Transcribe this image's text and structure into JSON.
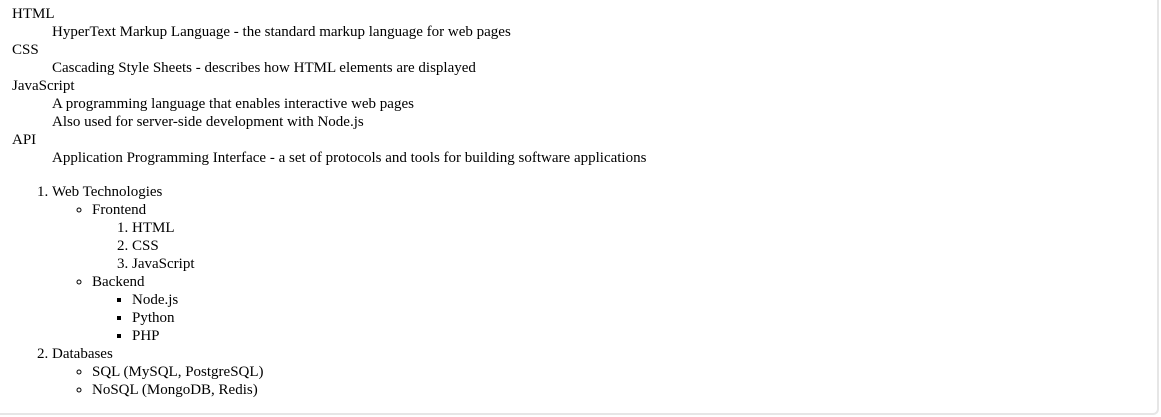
{
  "definitions": [
    {
      "term": "HTML",
      "descriptions": [
        "HyperText Markup Language - the standard markup language for web pages"
      ]
    },
    {
      "term": "CSS",
      "descriptions": [
        "Cascading Style Sheets - describes how HTML elements are displayed"
      ]
    },
    {
      "term": "JavaScript",
      "descriptions": [
        "A programming language that enables interactive web pages",
        "Also used for server-side development with Node.js"
      ]
    },
    {
      "term": "API",
      "descriptions": [
        "Application Programming Interface - a set of protocols and tools for building software applications"
      ]
    }
  ],
  "outline": {
    "items": [
      {
        "label": "Web Technologies",
        "children": [
          {
            "label": "Frontend",
            "children": [
              "HTML",
              "CSS",
              "JavaScript"
            ]
          },
          {
            "label": "Backend",
            "children": [
              "Node.js",
              "Python",
              "PHP"
            ]
          }
        ]
      },
      {
        "label": "Databases",
        "children": [
          "SQL (MySQL, PostgreSQL)",
          "NoSQL (MongoDB, Redis)"
        ]
      }
    ]
  }
}
